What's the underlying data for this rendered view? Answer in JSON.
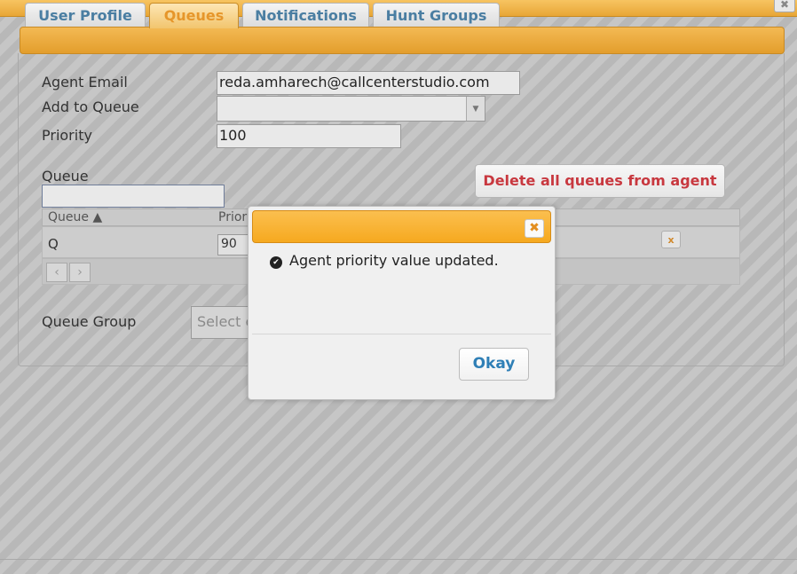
{
  "window": {
    "close_icon": "✖"
  },
  "tabs": [
    {
      "label": "User Profile",
      "active": false
    },
    {
      "label": "Queues",
      "active": true
    },
    {
      "label": "Notifications",
      "active": false
    },
    {
      "label": "Hunt Groups",
      "active": false
    }
  ],
  "form": {
    "agent_email_label": "Agent Email",
    "agent_email_value": "reda.amharech@callcenterstudio.com",
    "add_to_queue_label": "Add to Queue",
    "add_to_queue_value": "",
    "priority_label": "Priority",
    "priority_value": "100",
    "queue_label": "Queue",
    "queue_filter_value": "",
    "delete_all_label": "Delete all queues from agent",
    "queue_group_label": "Queue Group",
    "queue_group_placeholder": "Select c"
  },
  "grid": {
    "columns": [
      "Queue ▲",
      "Priori"
    ],
    "rows": [
      {
        "queue": "Q",
        "priority": "90"
      }
    ],
    "row_delete_icon": "x",
    "pager_prev": "‹",
    "pager_next": "›"
  },
  "modal": {
    "close_icon": "✖",
    "check_icon": "✔",
    "message": "Agent priority value updated.",
    "ok_label": "Okay"
  },
  "colors": {
    "accent_orange": "#f6a91f",
    "tab_text": "#4a7ea2",
    "danger_text": "#c8383f",
    "ok_text": "#2f7fb6"
  }
}
